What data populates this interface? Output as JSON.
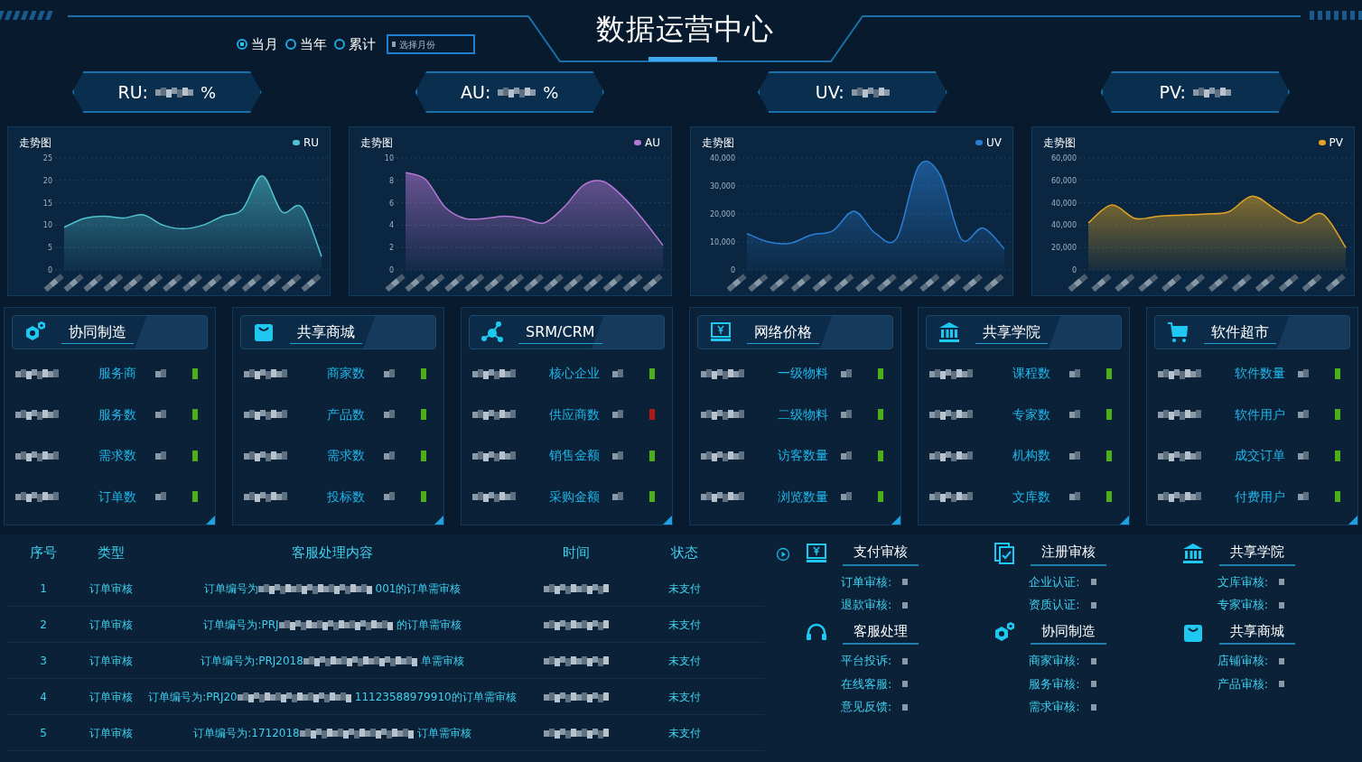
{
  "header": {
    "title": "数据运营中心",
    "period_options": [
      {
        "label": "当月",
        "selected": true
      },
      {
        "label": "当年",
        "selected": false
      },
      {
        "label": "累计",
        "selected": false
      }
    ],
    "month_picker": {
      "placeholder": "选择月份"
    }
  },
  "kpis": [
    {
      "label": "RU:",
      "suffix": "%"
    },
    {
      "label": "AU:",
      "suffix": "%"
    },
    {
      "label": "UV:"
    },
    {
      "label": "PV:"
    }
  ],
  "charts": [
    {
      "title": "走势图",
      "chart_data": {
        "type": "area",
        "grid": true,
        "series": [
          {
            "name": "RU",
            "color": "#4fc3d0",
            "values": [
              9.5,
              11.5,
              12,
              11.6,
              12.3,
              10,
              9.2,
              10,
              12,
              13.5,
              21,
              13,
              14,
              3
            ]
          }
        ],
        "ylim": [
          0,
          25
        ],
        "yticks": [
          0,
          5,
          10,
          15,
          20,
          25
        ]
      }
    },
    {
      "title": "走势图",
      "chart_data": {
        "type": "area",
        "grid": true,
        "series": [
          {
            "name": "AU",
            "color": "#b678d6",
            "values": [
              8.7,
              8.1,
              5.6,
              4.6,
              4.6,
              4.8,
              4.6,
              4.2,
              5.6,
              7.6,
              7.9,
              6.5,
              4.5,
              2.2
            ]
          }
        ],
        "ylim": [
          0,
          10
        ],
        "yticks": [
          0,
          2,
          4,
          6,
          8,
          10
        ]
      }
    },
    {
      "title": "走势图",
      "chart_data": {
        "type": "area",
        "grid": true,
        "series": [
          {
            "name": "UV",
            "color": "#2a7fd4",
            "values": [
              13000,
              10000,
              9500,
              12500,
              14000,
              21000,
              13000,
              11500,
              37000,
              34000,
              11000,
              15000,
              7500
            ]
          }
        ],
        "ylim": [
          0,
          40000
        ],
        "yticks": [
          {
            "value": 0,
            "label": "0"
          },
          {
            "value": 10000,
            "label": "10,000"
          },
          {
            "value": 20000,
            "label": "20,000"
          },
          {
            "value": 30000,
            "label": "30,000"
          },
          {
            "value": 40000,
            "label": "40,000"
          }
        ]
      }
    },
    {
      "title": "走势图",
      "legend": "PV",
      "y_labels": [
        "60,000",
        "60,000",
        "40,000",
        "40,000",
        "20,000",
        "0"
      ]
    }
  ],
  "cards": [
    {
      "title": "协同制造",
      "rows": [
        {
          "label": "服务商",
          "color": "#4caf1a"
        },
        {
          "label": "服务数",
          "color": "#4caf1a"
        },
        {
          "label": "需求数",
          "color": "#4caf1a"
        },
        {
          "label": "订单数",
          "color": "#4caf1a"
        }
      ]
    },
    {
      "title": "共享商城",
      "rows": [
        {
          "label": "商家数",
          "color": "#4caf1a"
        },
        {
          "label": "产品数",
          "color": "#4caf1a"
        },
        {
          "label": "需求数",
          "color": "#4caf1a"
        },
        {
          "label": "投标数",
          "color": "#4caf1a"
        }
      ]
    },
    {
      "title": "SRM/CRM",
      "rows": [
        {
          "label": "核心企业",
          "color": "#4caf1a"
        },
        {
          "label": "供应商数",
          "color": "#b01818"
        },
        {
          "label": "销售金额",
          "color": "#4caf1a"
        },
        {
          "label": "采购金额",
          "color": "#4caf1a"
        }
      ]
    },
    {
      "title": "网络价格",
      "rows": [
        {
          "label": "一级物料",
          "color": "#4caf1a"
        },
        {
          "label": "二级物料",
          "color": "#4caf1a"
        },
        {
          "label": "访客数量",
          "color": "#4caf1a"
        },
        {
          "label": "浏览数量",
          "color": "#4caf1a"
        }
      ]
    },
    {
      "title": "共享学院",
      "rows": [
        {
          "label": "课程数",
          "color": "#4caf1a"
        },
        {
          "label": "专家数",
          "color": "#4caf1a"
        },
        {
          "label": "机构数",
          "color": "#4caf1a"
        },
        {
          "label": "文库数",
          "color": "#4caf1a"
        }
      ]
    },
    {
      "title": "软件超市",
      "rows": [
        {
          "label": "软件数量",
          "color": "#4caf1a"
        },
        {
          "label": "软件用户",
          "color": "#4caf1a"
        },
        {
          "label": "成交订单",
          "color": "#4caf1a"
        },
        {
          "label": "付费用户",
          "color": "#4caf1a"
        }
      ]
    }
  ],
  "table": {
    "columns": [
      "序号",
      "类型",
      "客服处理内容",
      "时间",
      "状态"
    ],
    "rows": [
      {
        "index": "1",
        "type": "订单审核",
        "content_start": "订单编号为",
        "content_end": "001的订单需审核",
        "status": "未支付"
      },
      {
        "index": "2",
        "type": "订单审核",
        "content_start": "订单编号为:PRJ",
        "content_end": "的订单需审核",
        "status": "未支付"
      },
      {
        "index": "3",
        "type": "订单审核",
        "content_start": "订单编号为:PRJ2018",
        "content_end": "单需审核",
        "status": "未支付"
      },
      {
        "index": "4",
        "type": "订单审核",
        "content_start": "订单编号为:PRJ20",
        "content_end": "11123588979910的订单需审核",
        "status": "未支付"
      },
      {
        "index": "5",
        "type": "订单审核",
        "content_start": "订单编号为:1712018",
        "content_end": "订单需审核",
        "status": "未支付"
      }
    ]
  },
  "review_groups": [
    {
      "title": "支付审核",
      "items": [
        "订单审核:",
        "退款审核:"
      ]
    },
    {
      "title": "注册审核",
      "items": [
        "企业认证:",
        "资质认证:"
      ]
    },
    {
      "title": "共享学院",
      "items": [
        "文库审核:",
        "专家审核:"
      ]
    },
    {
      "title": "客服处理",
      "items": [
        "平台投诉:",
        "在线客服:",
        "意见反馈:"
      ]
    },
    {
      "title": "协同制造",
      "items": [
        "商家审核:",
        "服务审核:",
        "需求审核:"
      ]
    },
    {
      "title": "共享商城",
      "items": [
        "店铺审核:",
        "产品审核:"
      ]
    }
  ]
}
